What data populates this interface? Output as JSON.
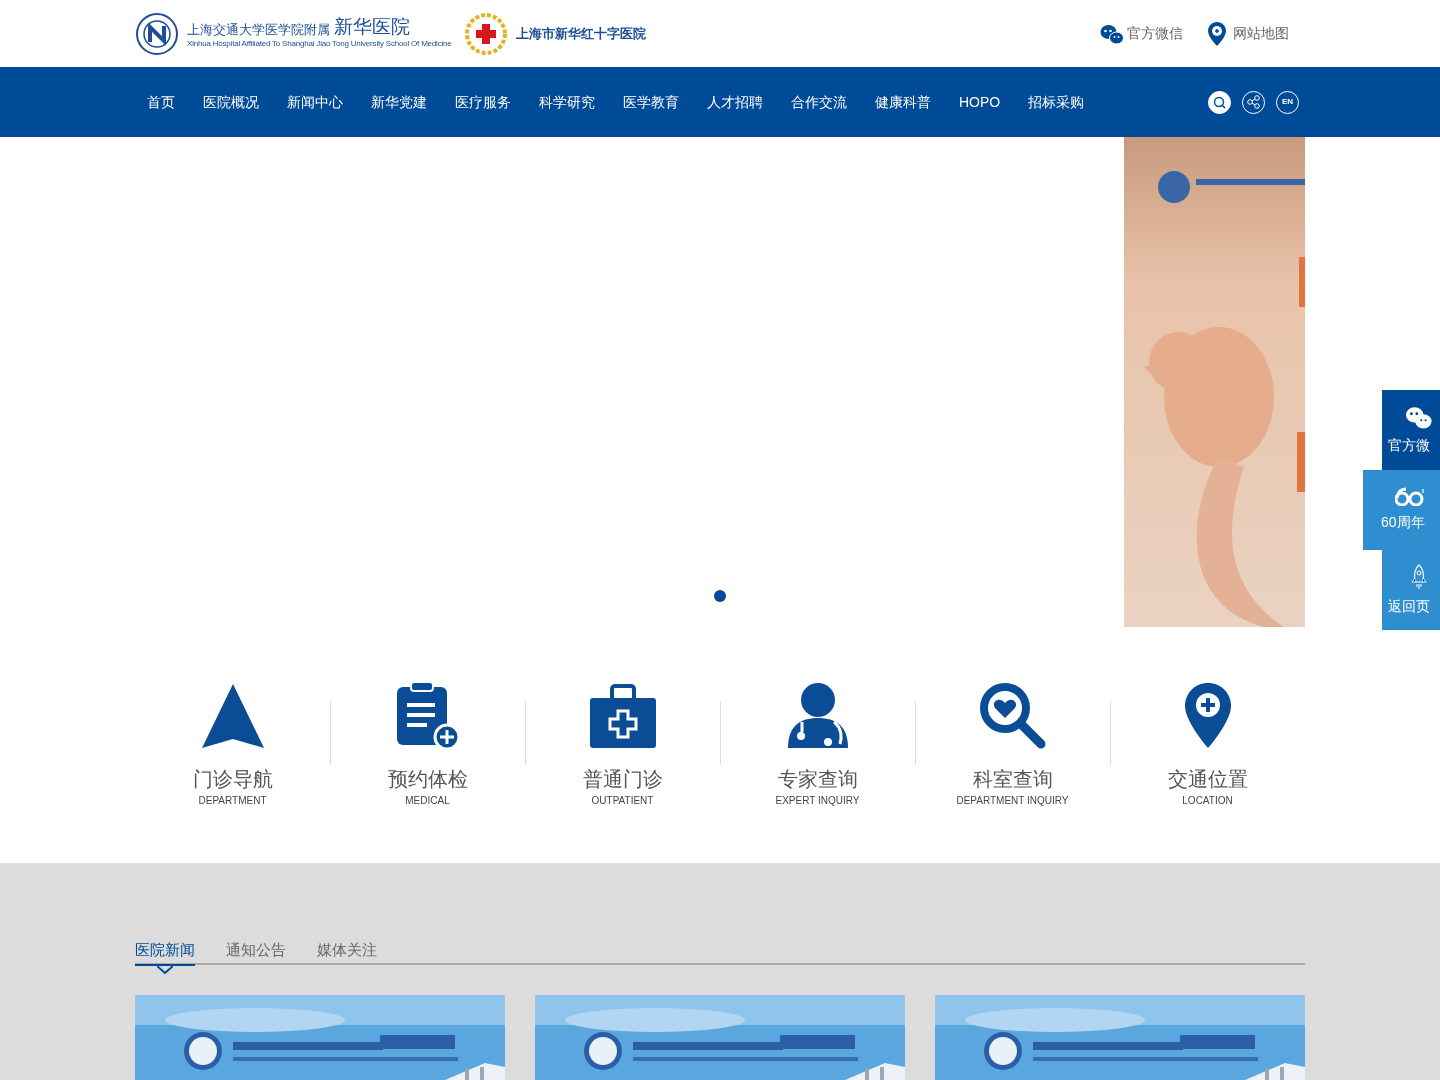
{
  "header": {
    "logo_title": "上海交通大学医学院附属",
    "logo_name": "新华医院",
    "logo_subtitle": "Xinhua Hospital Affiliated To Shanghai Jiao Tong University School Of Medicine",
    "red_cross_name": "上海市新华红十字医院",
    "links": [
      {
        "kind": "wechat",
        "label": "官方微信"
      },
      {
        "kind": "map",
        "label": "网站地图"
      }
    ]
  },
  "nav": {
    "items": [
      "首页",
      "医院概况",
      "新闻中心",
      "新华党建",
      "医疗服务",
      "科学研究",
      "医学教育",
      "人才招聘",
      "合作交流",
      "健康科普",
      "HOPO",
      "招标采购"
    ],
    "tools": [
      {
        "kind": "search",
        "selected": true
      },
      {
        "kind": "share",
        "selected": false
      },
      {
        "kind": "lang",
        "label": "EN",
        "selected": false
      }
    ]
  },
  "banner": {
    "dots": [
      {
        "selected": true
      }
    ]
  },
  "side_panel": [
    {
      "kind": "wechat",
      "label": "官方微",
      "color": "#004b97"
    },
    {
      "kind": "anniversary",
      "label": "60周年",
      "color": "#2f8ecf"
    },
    {
      "kind": "top",
      "label": "返回页",
      "color": "#2f8ecf"
    }
  ],
  "quick_links": [
    {
      "kind": "nav",
      "title": "门诊导航",
      "subtitle": "DEPARTMENT"
    },
    {
      "kind": "clipboard",
      "title": "预约体检",
      "subtitle": "MEDICAL"
    },
    {
      "kind": "kit",
      "title": "普通门诊",
      "subtitle": "OUTPATIENT"
    },
    {
      "kind": "doctor",
      "title": "专家查询",
      "subtitle": "EXPERT INQUIRY"
    },
    {
      "kind": "search",
      "title": "科室查询",
      "subtitle": "DEPARTMENT INQUIRY"
    },
    {
      "kind": "pin",
      "title": "交通位置",
      "subtitle": "LOCATION"
    }
  ],
  "news": {
    "tabs": [
      {
        "label": "医院新闻",
        "selected": true
      },
      {
        "label": "通知公告",
        "selected": false
      },
      {
        "label": "媒体关注",
        "selected": false
      }
    ]
  }
}
